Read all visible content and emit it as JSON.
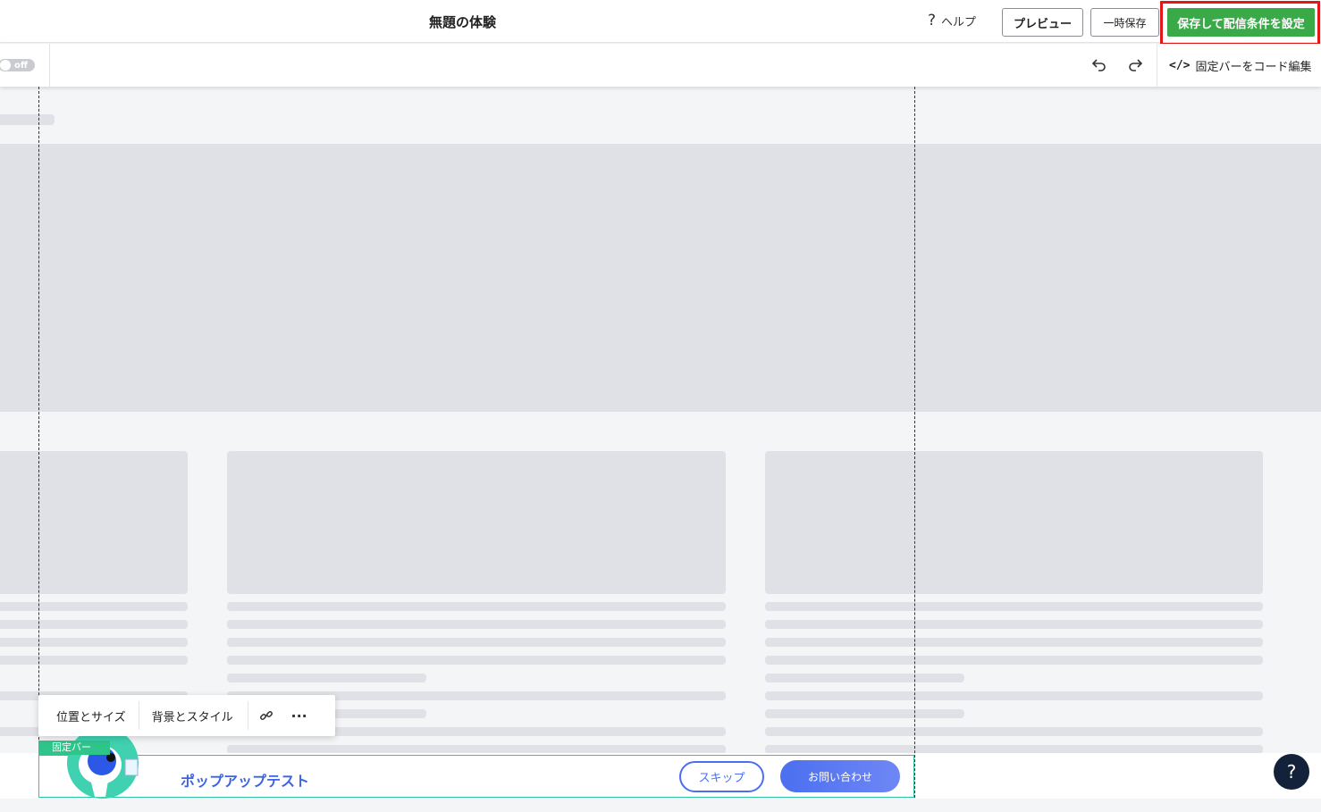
{
  "header": {
    "title": "無題の体験",
    "help_label": "ヘルプ",
    "preview_label": "プレビュー",
    "temp_save_label": "一時保存",
    "save_label": "保存して配信条件を設定"
  },
  "subbar": {
    "toggle_label": "off",
    "code_edit_label": "固定バーをコード編集"
  },
  "element_toolbar": {
    "position_size_label": "位置とサイズ",
    "bg_style_label": "背景とスタイル"
  },
  "fixed_bar": {
    "tag_label": "固定バー",
    "title": "ポップアップテスト",
    "skip_label": "スキップ",
    "contact_label": "お問い合わせ"
  },
  "help_fab_label": "?",
  "colors": {
    "save_button": "#3aaa48",
    "highlight_border": "#e21818",
    "bar_border": "#2ec4a0",
    "accent_blue": "#4b6ff0",
    "help_fab": "#14213a"
  }
}
